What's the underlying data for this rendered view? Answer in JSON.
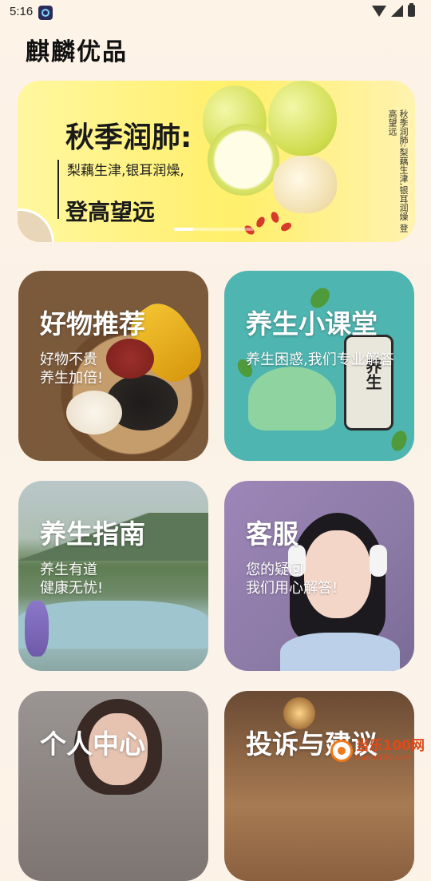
{
  "status_bar": {
    "time": "5:16"
  },
  "app_title": "麒麟优品",
  "banner": {
    "title": "秋季润肺:",
    "subtitle": "梨藕生津,银耳润燥,",
    "subtitle2": "登高望远",
    "vertical_text": "秋季润肺:梨藕生津,银耳润燥 登高望远"
  },
  "cards": [
    {
      "title": "好物推荐",
      "subtitle": "好物不贵\n养生加倍!"
    },
    {
      "title": "养生小课堂",
      "subtitle": "养生困惑,我们专业解答",
      "can_label": "养生"
    },
    {
      "title": "养生指南",
      "subtitle": "养生有道\n健康无忧!"
    },
    {
      "title": "客服",
      "subtitle": "您的疑问\n我们用心解答!"
    },
    {
      "title": "个人中心",
      "subtitle": ""
    },
    {
      "title": "投诉与建议",
      "subtitle": ""
    }
  ],
  "watermark": {
    "text": "当乐100网",
    "url": "duohi100.com"
  }
}
